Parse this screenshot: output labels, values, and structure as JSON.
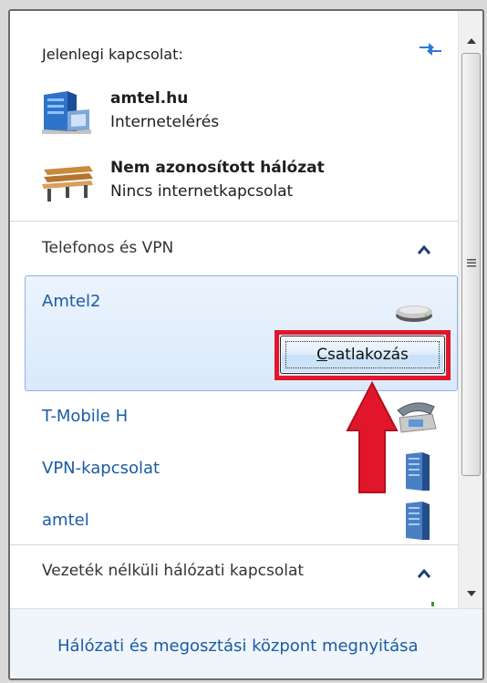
{
  "current_connection": {
    "header": "Jelenlegi kapcsolat:",
    "connections": [
      {
        "name": "amtel.hu",
        "status": "Internetelérés",
        "icon": "network-server-icon"
      },
      {
        "name": "Nem azonosított hálózat",
        "status": "Nincs internetkapcsolat",
        "icon": "park-bench-icon"
      }
    ],
    "refresh_icon": "refresh-arrows-icon"
  },
  "dialup_vpn": {
    "section_label": "Telefonos és VPN",
    "selected": {
      "name": "Amtel2",
      "icon": "modem-icon",
      "connect_label": "Csatlakozás",
      "connect_mnemonic": "C",
      "connect_rest": "satlakozás"
    },
    "items": [
      {
        "name": "T-Mobile H",
        "icon": "telephone-icon"
      },
      {
        "name": "VPN-kapcsolat",
        "icon": "vpn-server-icon"
      },
      {
        "name": "amtel",
        "icon": "vpn-server-icon"
      }
    ]
  },
  "wireless": {
    "section_label": "Vezeték nélküli hálózati kapcsolat"
  },
  "footer": {
    "link": "Hálózati és megosztási központ megnyitása"
  },
  "colors": {
    "link": "#1a5ba6",
    "selection": "#d9e9fb",
    "annotation": "#e2162b"
  }
}
